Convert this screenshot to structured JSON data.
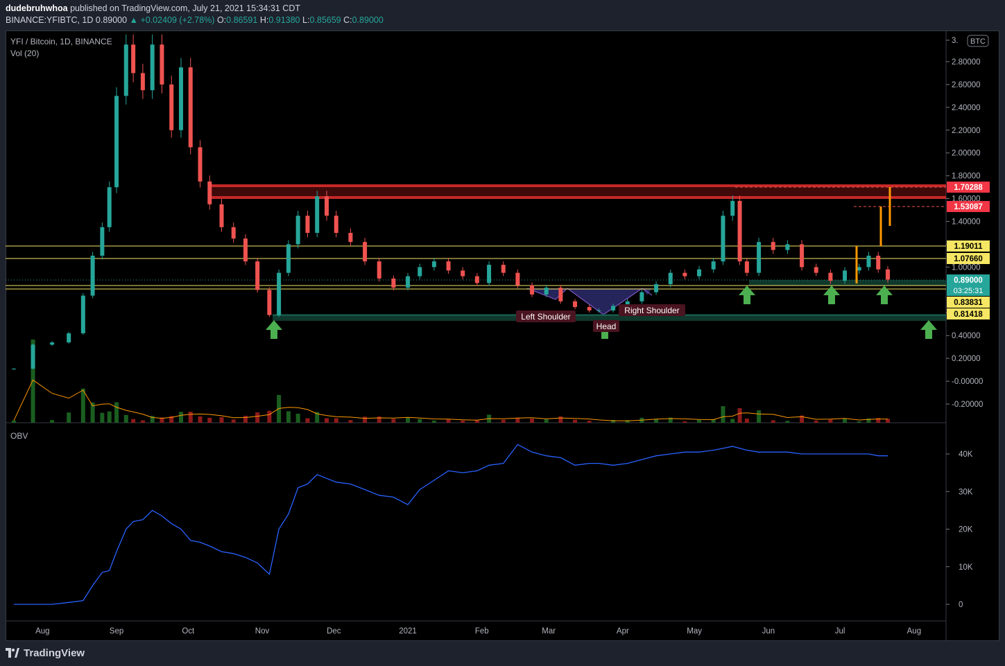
{
  "header": {
    "author": "dudebruhwhoa",
    "published_text": "published on TradingView.com, July 21, 2021 15:34:31 CDT",
    "symbol": "BINANCE:YFIBTC, 1D",
    "price": "0.89000",
    "change": "+0.02409 (+2.78%)",
    "open_label": "O:",
    "open": "0.86591",
    "high_label": "H:",
    "high": "0.91380",
    "low_label": "L:",
    "low": "0.85659",
    "close_label": "C:",
    "close": "0.89000"
  },
  "legend": {
    "title": "YFI / Bitcoin, 1D, BINANCE",
    "volume": "Vol (20)",
    "obv": "OBV"
  },
  "currency_badge": "BTC",
  "footer": {
    "brand": "TradingView"
  },
  "colors": {
    "up": "#26a69a",
    "down": "#ef5350",
    "background": "#000000",
    "resistance": "#b71c1c",
    "support": "#1b5e4a",
    "level": "#f5e663",
    "target": "#ff9800",
    "arrow": "#4caf50",
    "obv": "#2962ff",
    "vol_ma": "#ff9800"
  },
  "annotations": {
    "left_shoulder": "Left Shoulder",
    "head": "Head",
    "right_shoulder": "Right Shoulder"
  },
  "chart_data": [
    {
      "type": "candlestick",
      "title": "YFI / Bitcoin, 1D, BINANCE",
      "x_ticks": [
        "Aug",
        "Sep",
        "Oct",
        "Nov",
        "Dec",
        "2021",
        "Feb",
        "Mar",
        "Apr",
        "May",
        "Jun",
        "Jul",
        "Aug"
      ],
      "y_ticks": [
        "3.",
        "2.80000",
        "2.60000",
        "2.40000",
        "2.20000",
        "2.00000",
        "1.80000",
        "1.60000",
        "1.40000",
        "1.20000",
        "1.00000",
        "0.60000",
        "0.40000",
        "0.20000",
        "-0.00000",
        "-0.20000"
      ],
      "ylim": [
        -0.35,
        3.1
      ],
      "series": [
        {
          "name": "YFIBTC",
          "x": [
            "2020-07-20",
            "2020-07-28",
            "2020-08-05",
            "2020-08-12",
            "2020-08-18",
            "2020-08-22",
            "2020-08-26",
            "2020-08-29",
            "2020-09-01",
            "2020-09-05",
            "2020-09-08",
            "2020-09-12",
            "2020-09-16",
            "2020-09-20",
            "2020-09-24",
            "2020-09-28",
            "2020-10-02",
            "2020-10-06",
            "2020-10-10",
            "2020-10-15",
            "2020-10-20",
            "2020-10-25",
            "2020-10-30",
            "2020-11-04",
            "2020-11-08",
            "2020-11-12",
            "2020-11-16",
            "2020-11-20",
            "2020-11-24",
            "2020-11-28",
            "2020-12-02",
            "2020-12-08",
            "2020-12-14",
            "2020-12-20",
            "2020-12-26",
            "2021-01-01",
            "2021-01-06",
            "2021-01-12",
            "2021-01-18",
            "2021-01-24",
            "2021-01-30",
            "2021-02-04",
            "2021-02-10",
            "2021-02-16",
            "2021-02-22",
            "2021-02-28",
            "2021-03-06",
            "2021-03-12",
            "2021-03-18",
            "2021-03-22",
            "2021-03-28",
            "2021-04-03",
            "2021-04-09",
            "2021-04-15",
            "2021-04-21",
            "2021-04-27",
            "2021-05-03",
            "2021-05-09",
            "2021-05-13",
            "2021-05-17",
            "2021-05-20",
            "2021-05-23",
            "2021-05-28",
            "2021-06-03",
            "2021-06-09",
            "2021-06-15",
            "2021-06-21",
            "2021-06-27",
            "2021-07-03",
            "2021-07-09",
            "2021-07-13",
            "2021-07-17",
            "2021-07-21"
          ],
          "close": [
            0.11,
            0.32,
            0.34,
            0.42,
            0.75,
            1.1,
            1.35,
            1.7,
            2.5,
            2.95,
            2.7,
            2.55,
            2.95,
            2.6,
            2.2,
            2.75,
            2.05,
            1.75,
            1.55,
            1.35,
            1.25,
            1.05,
            0.8,
            0.58,
            0.95,
            1.2,
            1.45,
            1.3,
            1.62,
            1.45,
            1.3,
            1.22,
            1.05,
            0.9,
            0.82,
            0.92,
            1.0,
            1.05,
            0.97,
            0.92,
            0.86,
            1.02,
            0.95,
            0.84,
            0.76,
            0.82,
            0.7,
            0.65,
            0.62,
            0.62,
            0.66,
            0.7,
            0.78,
            0.85,
            0.95,
            0.92,
            0.98,
            1.05,
            1.45,
            1.58,
            1.05,
            0.95,
            1.22,
            1.15,
            1.2,
            1.0,
            0.95,
            0.88,
            0.97,
            1.0,
            1.1,
            0.98,
            0.89
          ]
        }
      ],
      "levels": [
        {
          "label": "1.70288",
          "value": 1.70288,
          "kind": "resistance"
        },
        {
          "label": "1.53087",
          "value": 1.53087,
          "kind": "target"
        },
        {
          "label": "1.19011",
          "value": 1.19011,
          "kind": "level"
        },
        {
          "label": "1.07660",
          "value": 1.0766,
          "kind": "level"
        },
        {
          "label": "0.89000",
          "value": 0.89,
          "kind": "last"
        },
        {
          "label": "0.83831",
          "value": 0.83831,
          "kind": "level"
        },
        {
          "label": "0.81418",
          "value": 0.81418,
          "kind": "level"
        }
      ],
      "countdown": "03:25:31"
    },
    {
      "type": "bar",
      "title": "Vol (20)",
      "note": "volume histogram with 20-period moving average, relative heights"
    },
    {
      "type": "line",
      "title": "OBV",
      "y_ticks": [
        "40K",
        "30K",
        "20K",
        "10K",
        "0"
      ],
      "ylim": [
        -5,
        47
      ],
      "series": [
        {
          "name": "OBV",
          "x": [
            "2020-07-20",
            "2020-07-28",
            "2020-08-05",
            "2020-08-12",
            "2020-08-18",
            "2020-08-22",
            "2020-08-26",
            "2020-08-29",
            "2020-09-01",
            "2020-09-05",
            "2020-09-08",
            "2020-09-12",
            "2020-09-16",
            "2020-09-20",
            "2020-09-24",
            "2020-09-28",
            "2020-10-02",
            "2020-10-06",
            "2020-10-10",
            "2020-10-15",
            "2020-10-20",
            "2020-10-25",
            "2020-10-30",
            "2020-11-04",
            "2020-11-08",
            "2020-11-12",
            "2020-11-16",
            "2020-11-20",
            "2020-11-24",
            "2020-11-28",
            "2020-12-02",
            "2020-12-08",
            "2020-12-14",
            "2020-12-20",
            "2020-12-26",
            "2021-01-01",
            "2021-01-06",
            "2021-01-12",
            "2021-01-18",
            "2021-01-24",
            "2021-01-30",
            "2021-02-04",
            "2021-02-10",
            "2021-02-16",
            "2021-02-22",
            "2021-02-28",
            "2021-03-06",
            "2021-03-12",
            "2021-03-18",
            "2021-03-22",
            "2021-03-28",
            "2021-04-03",
            "2021-04-09",
            "2021-04-15",
            "2021-04-21",
            "2021-04-27",
            "2021-05-03",
            "2021-05-09",
            "2021-05-13",
            "2021-05-17",
            "2021-05-20",
            "2021-05-23",
            "2021-05-28",
            "2021-06-03",
            "2021-06-09",
            "2021-06-15",
            "2021-06-21",
            "2021-06-27",
            "2021-07-03",
            "2021-07-09",
            "2021-07-13",
            "2021-07-17",
            "2021-07-21"
          ],
          "values": [
            0.0,
            0.0,
            0.0,
            0.5,
            1.0,
            5.0,
            8.5,
            9.0,
            14.0,
            20.0,
            22.0,
            22.5,
            25.0,
            23.5,
            21.5,
            20.0,
            17.0,
            16.5,
            15.5,
            14.0,
            13.5,
            12.5,
            11.0,
            8.0,
            20.0,
            24.0,
            31.0,
            32.0,
            34.5,
            33.5,
            32.5,
            32.0,
            30.5,
            29.0,
            28.5,
            26.5,
            30.5,
            33.0,
            35.5,
            35.0,
            35.5,
            37.0,
            37.5,
            42.5,
            40.5,
            39.5,
            39.0,
            37.0,
            37.5,
            37.5,
            37.0,
            37.5,
            38.5,
            39.5,
            40.0,
            40.5,
            40.5,
            41.0,
            41.5,
            42.0,
            41.5,
            41.0,
            40.5,
            40.5,
            40.5,
            40.0,
            40.0,
            40.0,
            40.0,
            40.0,
            40.0,
            39.5,
            39.5
          ]
        }
      ]
    }
  ]
}
